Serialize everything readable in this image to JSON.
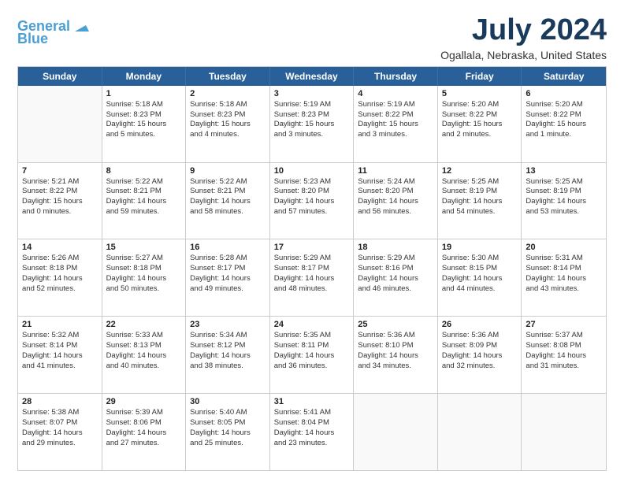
{
  "header": {
    "logo_general": "General",
    "logo_blue": "Blue",
    "title": "July 2024",
    "subtitle": "Ogallala, Nebraska, United States"
  },
  "calendar": {
    "days_of_week": [
      "Sunday",
      "Monday",
      "Tuesday",
      "Wednesday",
      "Thursday",
      "Friday",
      "Saturday"
    ],
    "rows": [
      [
        {
          "day": "",
          "empty": true
        },
        {
          "day": "1",
          "line1": "Sunrise: 5:18 AM",
          "line2": "Sunset: 8:23 PM",
          "line3": "Daylight: 15 hours",
          "line4": "and 5 minutes."
        },
        {
          "day": "2",
          "line1": "Sunrise: 5:18 AM",
          "line2": "Sunset: 8:23 PM",
          "line3": "Daylight: 15 hours",
          "line4": "and 4 minutes."
        },
        {
          "day": "3",
          "line1": "Sunrise: 5:19 AM",
          "line2": "Sunset: 8:23 PM",
          "line3": "Daylight: 15 hours",
          "line4": "and 3 minutes."
        },
        {
          "day": "4",
          "line1": "Sunrise: 5:19 AM",
          "line2": "Sunset: 8:22 PM",
          "line3": "Daylight: 15 hours",
          "line4": "and 3 minutes."
        },
        {
          "day": "5",
          "line1": "Sunrise: 5:20 AM",
          "line2": "Sunset: 8:22 PM",
          "line3": "Daylight: 15 hours",
          "line4": "and 2 minutes."
        },
        {
          "day": "6",
          "line1": "Sunrise: 5:20 AM",
          "line2": "Sunset: 8:22 PM",
          "line3": "Daylight: 15 hours",
          "line4": "and 1 minute."
        }
      ],
      [
        {
          "day": "7",
          "line1": "Sunrise: 5:21 AM",
          "line2": "Sunset: 8:22 PM",
          "line3": "Daylight: 15 hours",
          "line4": "and 0 minutes."
        },
        {
          "day": "8",
          "line1": "Sunrise: 5:22 AM",
          "line2": "Sunset: 8:21 PM",
          "line3": "Daylight: 14 hours",
          "line4": "and 59 minutes."
        },
        {
          "day": "9",
          "line1": "Sunrise: 5:22 AM",
          "line2": "Sunset: 8:21 PM",
          "line3": "Daylight: 14 hours",
          "line4": "and 58 minutes."
        },
        {
          "day": "10",
          "line1": "Sunrise: 5:23 AM",
          "line2": "Sunset: 8:20 PM",
          "line3": "Daylight: 14 hours",
          "line4": "and 57 minutes."
        },
        {
          "day": "11",
          "line1": "Sunrise: 5:24 AM",
          "line2": "Sunset: 8:20 PM",
          "line3": "Daylight: 14 hours",
          "line4": "and 56 minutes."
        },
        {
          "day": "12",
          "line1": "Sunrise: 5:25 AM",
          "line2": "Sunset: 8:19 PM",
          "line3": "Daylight: 14 hours",
          "line4": "and 54 minutes."
        },
        {
          "day": "13",
          "line1": "Sunrise: 5:25 AM",
          "line2": "Sunset: 8:19 PM",
          "line3": "Daylight: 14 hours",
          "line4": "and 53 minutes."
        }
      ],
      [
        {
          "day": "14",
          "line1": "Sunrise: 5:26 AM",
          "line2": "Sunset: 8:18 PM",
          "line3": "Daylight: 14 hours",
          "line4": "and 52 minutes."
        },
        {
          "day": "15",
          "line1": "Sunrise: 5:27 AM",
          "line2": "Sunset: 8:18 PM",
          "line3": "Daylight: 14 hours",
          "line4": "and 50 minutes."
        },
        {
          "day": "16",
          "line1": "Sunrise: 5:28 AM",
          "line2": "Sunset: 8:17 PM",
          "line3": "Daylight: 14 hours",
          "line4": "and 49 minutes."
        },
        {
          "day": "17",
          "line1": "Sunrise: 5:29 AM",
          "line2": "Sunset: 8:17 PM",
          "line3": "Daylight: 14 hours",
          "line4": "and 48 minutes."
        },
        {
          "day": "18",
          "line1": "Sunrise: 5:29 AM",
          "line2": "Sunset: 8:16 PM",
          "line3": "Daylight: 14 hours",
          "line4": "and 46 minutes."
        },
        {
          "day": "19",
          "line1": "Sunrise: 5:30 AM",
          "line2": "Sunset: 8:15 PM",
          "line3": "Daylight: 14 hours",
          "line4": "and 44 minutes."
        },
        {
          "day": "20",
          "line1": "Sunrise: 5:31 AM",
          "line2": "Sunset: 8:14 PM",
          "line3": "Daylight: 14 hours",
          "line4": "and 43 minutes."
        }
      ],
      [
        {
          "day": "21",
          "line1": "Sunrise: 5:32 AM",
          "line2": "Sunset: 8:14 PM",
          "line3": "Daylight: 14 hours",
          "line4": "and 41 minutes."
        },
        {
          "day": "22",
          "line1": "Sunrise: 5:33 AM",
          "line2": "Sunset: 8:13 PM",
          "line3": "Daylight: 14 hours",
          "line4": "and 40 minutes."
        },
        {
          "day": "23",
          "line1": "Sunrise: 5:34 AM",
          "line2": "Sunset: 8:12 PM",
          "line3": "Daylight: 14 hours",
          "line4": "and 38 minutes."
        },
        {
          "day": "24",
          "line1": "Sunrise: 5:35 AM",
          "line2": "Sunset: 8:11 PM",
          "line3": "Daylight: 14 hours",
          "line4": "and 36 minutes."
        },
        {
          "day": "25",
          "line1": "Sunrise: 5:36 AM",
          "line2": "Sunset: 8:10 PM",
          "line3": "Daylight: 14 hours",
          "line4": "and 34 minutes."
        },
        {
          "day": "26",
          "line1": "Sunrise: 5:36 AM",
          "line2": "Sunset: 8:09 PM",
          "line3": "Daylight: 14 hours",
          "line4": "and 32 minutes."
        },
        {
          "day": "27",
          "line1": "Sunrise: 5:37 AM",
          "line2": "Sunset: 8:08 PM",
          "line3": "Daylight: 14 hours",
          "line4": "and 31 minutes."
        }
      ],
      [
        {
          "day": "28",
          "line1": "Sunrise: 5:38 AM",
          "line2": "Sunset: 8:07 PM",
          "line3": "Daylight: 14 hours",
          "line4": "and 29 minutes."
        },
        {
          "day": "29",
          "line1": "Sunrise: 5:39 AM",
          "line2": "Sunset: 8:06 PM",
          "line3": "Daylight: 14 hours",
          "line4": "and 27 minutes."
        },
        {
          "day": "30",
          "line1": "Sunrise: 5:40 AM",
          "line2": "Sunset: 8:05 PM",
          "line3": "Daylight: 14 hours",
          "line4": "and 25 minutes."
        },
        {
          "day": "31",
          "line1": "Sunrise: 5:41 AM",
          "line2": "Sunset: 8:04 PM",
          "line3": "Daylight: 14 hours",
          "line4": "and 23 minutes."
        },
        {
          "day": "",
          "empty": true
        },
        {
          "day": "",
          "empty": true
        },
        {
          "day": "",
          "empty": true
        }
      ]
    ]
  }
}
